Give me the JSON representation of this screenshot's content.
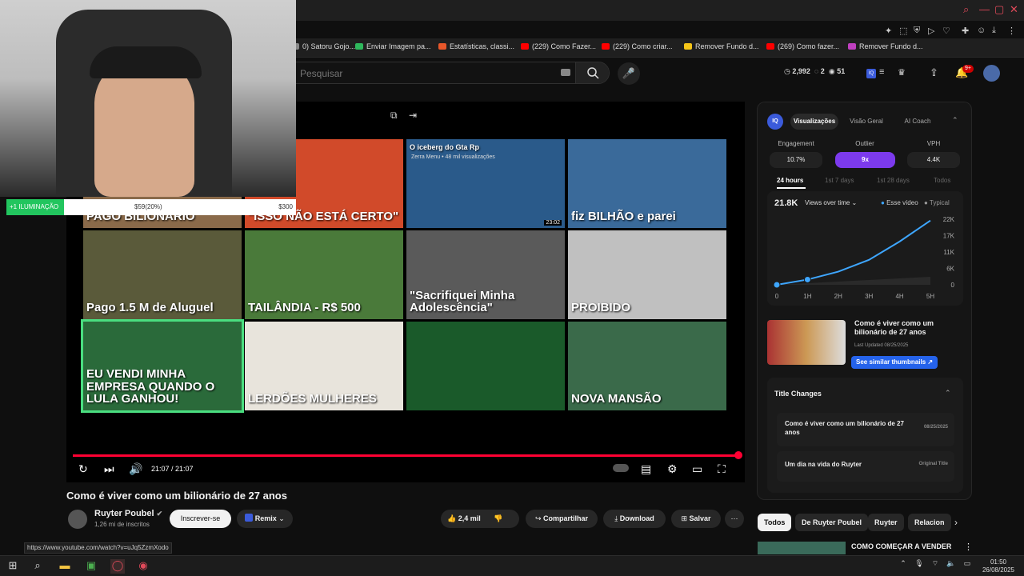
{
  "browser": {
    "bookmarks": [
      {
        "label": "0) Satoru Gojo...",
        "color": "#888888"
      },
      {
        "label": "Enviar Imagem pa...",
        "color": "#2eb85c"
      },
      {
        "label": "Estatísticas, classi...",
        "color": "#e8572a"
      },
      {
        "label": "(229) Como Fazer...",
        "color": "#ff0000"
      },
      {
        "label": "(229) Como criar...",
        "color": "#ff0000"
      },
      {
        "label": "Remover Fundo d...",
        "color": "#f5c518"
      },
      {
        "label": "(269) Como fazer...",
        "color": "#ff0000"
      },
      {
        "label": "Remover Fundo d...",
        "color": "#c040c0"
      }
    ],
    "status_url": "https://www.youtube.com/watch?v=uJq5ZzmXodo"
  },
  "youtube": {
    "search_placeholder": "Pesquisar",
    "header_stats": {
      "views": "2,992",
      "comments": "2",
      "eye": "51"
    },
    "notifications_badge": "9+",
    "video": {
      "title": "Como é viver como um bilionário de 27 anos",
      "time": "21:07 / 21:07",
      "channel": "Ruyter Poubel",
      "subscribers": "1,26 mi de inscritos",
      "subscribe_label": "Inscrever-se",
      "remix_label": "Remix",
      "likes": "2,4 mil",
      "share_label": "Compartilhar",
      "download_label": "Download",
      "save_label": "Salvar"
    },
    "endscreen": [
      {
        "caption": "PAGO BILIONÁRIO",
        "bg": "#8a6a4a"
      },
      {
        "caption": "\"ISSO NÃO ESTÁ CERTO\"",
        "bg": "#d14a2a"
      },
      {
        "caption": "O iceberg do Gta Rp",
        "sub": "Zerra Menu • 48 mil visualizações",
        "duration": "23:02",
        "bg": "#2a5a8a"
      },
      {
        "caption": "fiz BILHÃO e parei",
        "bg": "#3a6a9a"
      },
      {
        "caption": "Pago 1.5 M de Aluguel",
        "bg": "#5a5a3a"
      },
      {
        "caption": "TAILÂNDIA - R$ 500",
        "bg": "#4a7a3a"
      },
      {
        "caption": "\"Sacrifiquei Minha Adolescência\"",
        "bg": "#5a5a5a"
      },
      {
        "caption": "PROIBIDO",
        "bg": "#c0c0c0"
      },
      {
        "caption": "EU VENDI MINHA EMPRESA QUANDO O LULA GANHOU!",
        "bg": "#2a6a3a"
      },
      {
        "caption": "LERDÕES  MULHERES",
        "bg": "#e8e4dc"
      },
      {
        "caption": "",
        "bg": "#1a5a2a"
      },
      {
        "caption": "NOVA MANSÃO",
        "bg": "#3a6a4a"
      }
    ],
    "chips": [
      "Todos",
      "De Ruyter Poubel",
      "Ruyter",
      "Relacion"
    ],
    "next_video_title": "COMO COMEÇAR A VENDER"
  },
  "vidiq": {
    "tabs": [
      "Visualizações",
      "Visão Geral",
      "AI Coach"
    ],
    "metrics": [
      {
        "label": "Engagement",
        "value": "10.7%"
      },
      {
        "label": "Outlier",
        "value": "9x"
      },
      {
        "label": "VPH",
        "value": "4.4K"
      }
    ],
    "ranges": [
      "24 hours",
      "1st 7 days",
      "1st 28 days",
      "Todos"
    ],
    "views_total": "21.8K",
    "views_mode": "Views over time",
    "legend": [
      "Esse vídeo",
      "Typical"
    ],
    "chart_y_ticks": [
      "22K",
      "17K",
      "11K",
      "6K",
      "0"
    ],
    "chart_x_ticks": [
      "0",
      "1H",
      "2H",
      "3H",
      "4H",
      "5H"
    ],
    "thumb_title": "Como é viver como um bilionário de 27 anos",
    "thumb_updated": "Last Updated 08/25/2025",
    "similar_label": "See similar thumbnails",
    "title_changes_header": "Title Changes",
    "title_changes": [
      {
        "title": "Como é viver como um bilionário de 27 anos",
        "tag": "08/25/2025"
      },
      {
        "title": "Um dia na vida do Ruyter",
        "tag": "Original Title"
      }
    ],
    "accent": "#3ea6ff"
  },
  "overlay": {
    "light_label": "+1 ILUMINAÇÃO",
    "light_progress": "$59(20%)",
    "light_goal": "$300",
    "light_fraction": 0.2
  },
  "system": {
    "time": "01:50",
    "date": "26/08/2025"
  }
}
